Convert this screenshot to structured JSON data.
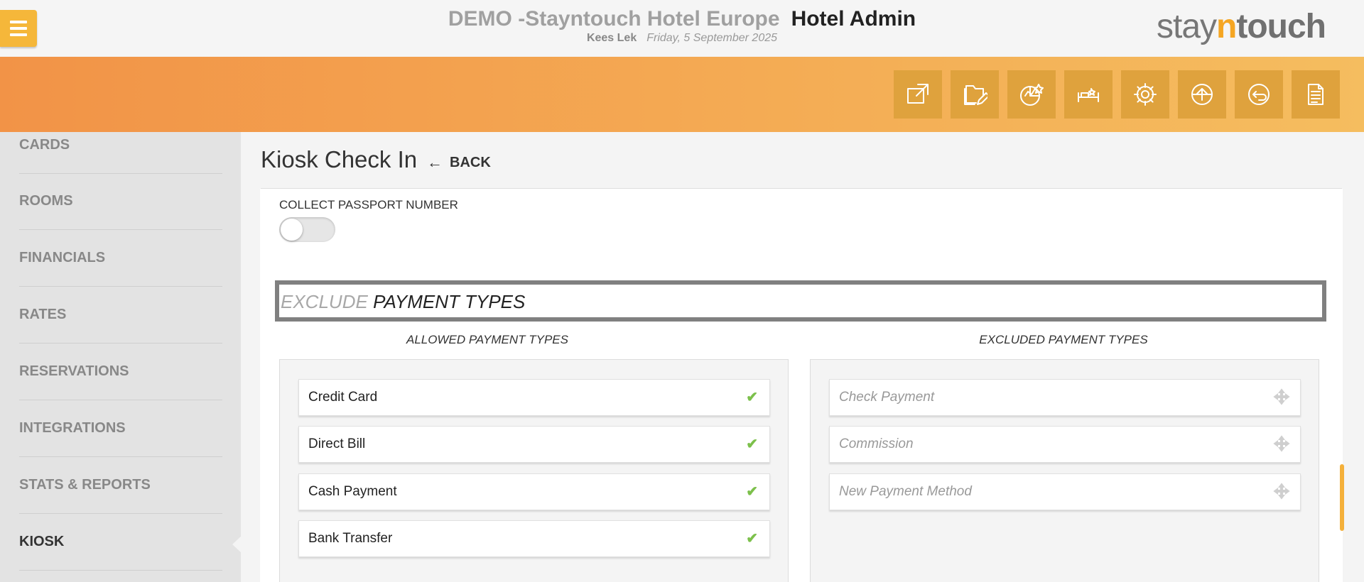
{
  "header": {
    "hotel_name": "DEMO -Stayntouch Hotel Europe",
    "app_name": "Hotel Admin",
    "user": "Kees Lek",
    "date": "Friday, 5 September 2025",
    "logo": {
      "pre": "stay",
      "n": "n",
      "post": "touch"
    }
  },
  "toolbar": {
    "icons": [
      "open-external-icon",
      "edit-folder-icon",
      "reports-chart-icon",
      "room-service-icon",
      "settings-gear-icon",
      "upload-icon",
      "history-back-icon",
      "document-icon"
    ]
  },
  "sidebar": {
    "items": [
      {
        "label": "CARDS"
      },
      {
        "label": "ROOMS"
      },
      {
        "label": "FINANCIALS"
      },
      {
        "label": "RATES"
      },
      {
        "label": "RESERVATIONS"
      },
      {
        "label": "INTEGRATIONS"
      },
      {
        "label": "STATS & REPORTS"
      },
      {
        "label": "KIOSK",
        "active": true
      }
    ]
  },
  "main": {
    "title": "Kiosk Check In",
    "back_label": "BACK",
    "toggle_label": "COLLECT PASSPORT NUMBER",
    "toggle_on": false,
    "section": {
      "exclude_word": "EXCLUDE",
      "rest": "PAYMENT TYPES"
    },
    "allowed_header": "ALLOWED PAYMENT TYPES",
    "excluded_header": "EXCLUDED PAYMENT TYPES",
    "allowed": [
      "Credit Card",
      "Direct Bill",
      "Cash Payment",
      "Bank Transfer"
    ],
    "excluded": [
      "Check Payment",
      "Commission",
      "New Payment Method"
    ],
    "check_glyph": "✔"
  },
  "colors": {
    "accent": "#f5a623",
    "band_start": "#f29347",
    "band_end": "#f5bd5f",
    "check": "#7cc04b"
  }
}
